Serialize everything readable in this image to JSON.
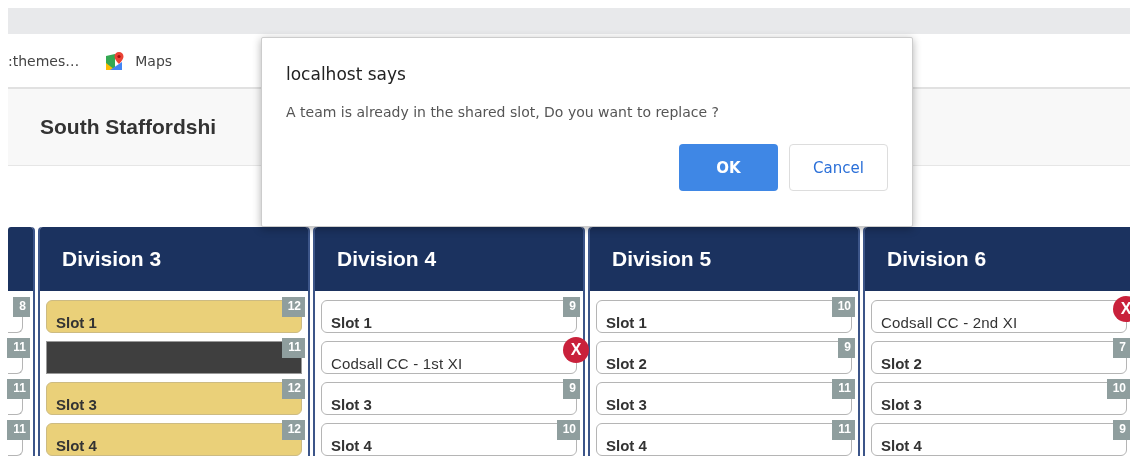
{
  "bookmarks": [
    {
      "label": ":themes…",
      "kind": "plain"
    },
    {
      "label": "Maps",
      "kind": "maps"
    }
  ],
  "page_header": {
    "title": "South Staffordshi"
  },
  "partial_column": {
    "slots": [
      {
        "badge": "8"
      },
      {
        "badge": "11"
      },
      {
        "badge": "11"
      },
      {
        "badge": "11"
      }
    ]
  },
  "divisions": [
    {
      "title": "Division 3",
      "slots": [
        {
          "kind": "shared",
          "label": "Slot 1",
          "badge": "12"
        },
        {
          "kind": "blocked",
          "badge": "11"
        },
        {
          "kind": "shared",
          "label": "Slot 3",
          "badge": "12"
        },
        {
          "kind": "shared",
          "label": "Slot 4",
          "badge": "12"
        }
      ]
    },
    {
      "title": "Division 4",
      "slots": [
        {
          "kind": "open",
          "label": "Slot 1",
          "badge": "9"
        },
        {
          "kind": "team",
          "label": "Codsall CC - 1st XI",
          "remove": "X"
        },
        {
          "kind": "open",
          "label": "Slot 3",
          "badge": "9"
        },
        {
          "kind": "open",
          "label": "Slot 4",
          "badge": "10"
        }
      ]
    },
    {
      "title": "Division 5",
      "slots": [
        {
          "kind": "open",
          "label": "Slot 1",
          "badge": "10"
        },
        {
          "kind": "open",
          "label": "Slot 2",
          "badge": "9"
        },
        {
          "kind": "open",
          "label": "Slot 3",
          "badge": "11"
        },
        {
          "kind": "open",
          "label": "Slot 4",
          "badge": "11"
        }
      ]
    },
    {
      "title": "Division 6",
      "slots": [
        {
          "kind": "team",
          "label": "Codsall CC - 2nd XI",
          "remove": "X"
        },
        {
          "kind": "open",
          "label": "Slot 2",
          "badge": "7"
        },
        {
          "kind": "open",
          "label": "Slot 3",
          "badge": "10"
        },
        {
          "kind": "open",
          "label": "Slot 4",
          "badge": "9"
        }
      ]
    }
  ],
  "dialog": {
    "title": "localhost says",
    "message": "A team is already in the shared slot, Do you want to replace ?",
    "buttons": [
      {
        "label": "OK",
        "kind": "primary"
      },
      {
        "label": "Cancel",
        "kind": "secondary"
      }
    ]
  }
}
